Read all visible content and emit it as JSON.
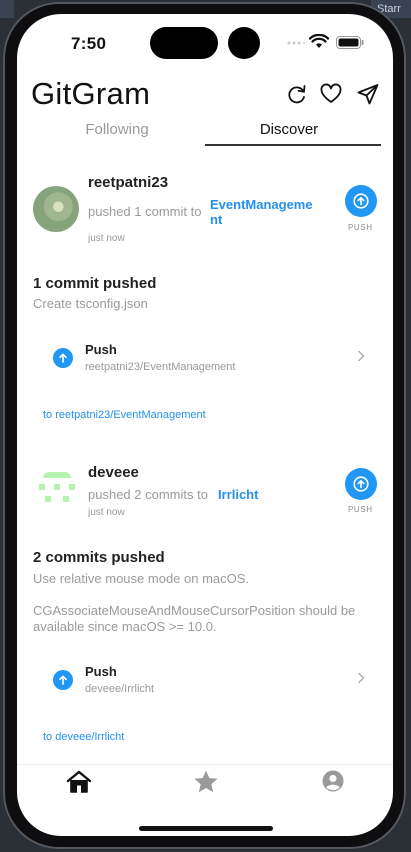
{
  "backdrop": {
    "tab_label": "Starr"
  },
  "status_bar": {
    "time": "7:50"
  },
  "header": {
    "title": "GitGram",
    "icons": [
      "refresh-icon",
      "heart-icon",
      "send-icon"
    ]
  },
  "tabs": [
    {
      "label": "Following",
      "active": false
    },
    {
      "label": "Discover",
      "active": true
    }
  ],
  "feed": [
    {
      "username": "reetpatni23",
      "action": "pushed 1 commit to",
      "repo_line1": "EventManageme",
      "repo_line2": "nt",
      "time": "just now",
      "badge_caption": "PUSH",
      "heading": "1 commit pushed",
      "messages": [
        "Create tsconfig.json"
      ],
      "push_title": "Push",
      "push_repo": "reetpatni23/EventManagement",
      "to_link": "to reetpatni23/EventManagement"
    },
    {
      "username": "deveee",
      "action": "pushed 2 commits to",
      "repo_line1": "Irrlicht",
      "time": "just now",
      "badge_caption": "PUSH",
      "heading": "2 commits pushed",
      "messages": [
        "Use relative mouse mode on macOS.",
        "CGAssociateMouseAndMouseCursorPosition should be available since macOS >= 10.0."
      ],
      "push_title": "Push",
      "push_repo": "deveee/Irrlicht",
      "to_link": "to deveee/Irrlicht"
    }
  ],
  "tab_bar": {
    "icons": [
      "home-icon",
      "star-icon",
      "profile-icon"
    ]
  },
  "colors": {
    "accent": "#2196f3",
    "link": "#2490f0",
    "muted": "#9a9a9a"
  }
}
